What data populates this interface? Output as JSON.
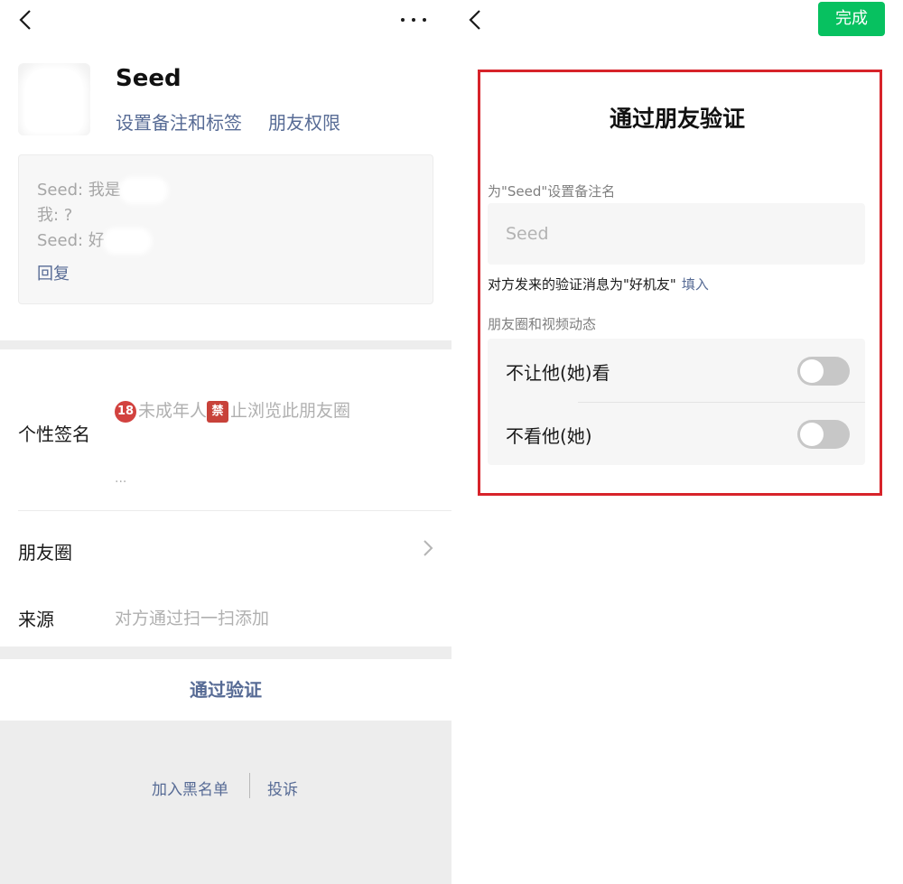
{
  "left_screen": {
    "profile": {
      "name": "Seed",
      "remark_tag_link": "设置备注和标签",
      "permission_link": "朋友权限"
    },
    "message_box": {
      "lines": [
        "Seed: 我是",
        "我: ?",
        "Seed: 好"
      ],
      "reply_label": "回复"
    },
    "signature": {
      "label": "个性签名",
      "emoji_18": "18",
      "text_part1": "未成年人",
      "emoji_ban": "禁",
      "text_part2": "止浏览此朋友圈",
      "ellipsis": "..."
    },
    "moments": {
      "label": "朋友圈"
    },
    "source": {
      "label": "来源",
      "value": "对方通过扫一扫添加"
    },
    "verify_button": "通过验证",
    "footer": {
      "blacklist": "加入黑名单",
      "report": "投诉"
    }
  },
  "right_screen": {
    "done_button": "完成",
    "title": "通过朋友验证",
    "remark_label": "为\"Seed\"设置备注名",
    "remark_placeholder": "Seed",
    "verify_message_text": "对方发来的验证消息为\"好机友\"",
    "verify_fill_link": "填入",
    "privacy_section_label": "朋友圈和视频动态",
    "privacy_settings": [
      {
        "label": "不让他(她)看",
        "enabled": false
      },
      {
        "label": "不看他(她)",
        "enabled": false
      }
    ],
    "highlight_color": "#d7232a",
    "accent_color": "#07c160",
    "link_color": "#576b95"
  },
  "icons": {
    "back": "chevron-left-icon",
    "more": "more-dots-icon",
    "moments_arrow": "chevron-right-icon"
  }
}
